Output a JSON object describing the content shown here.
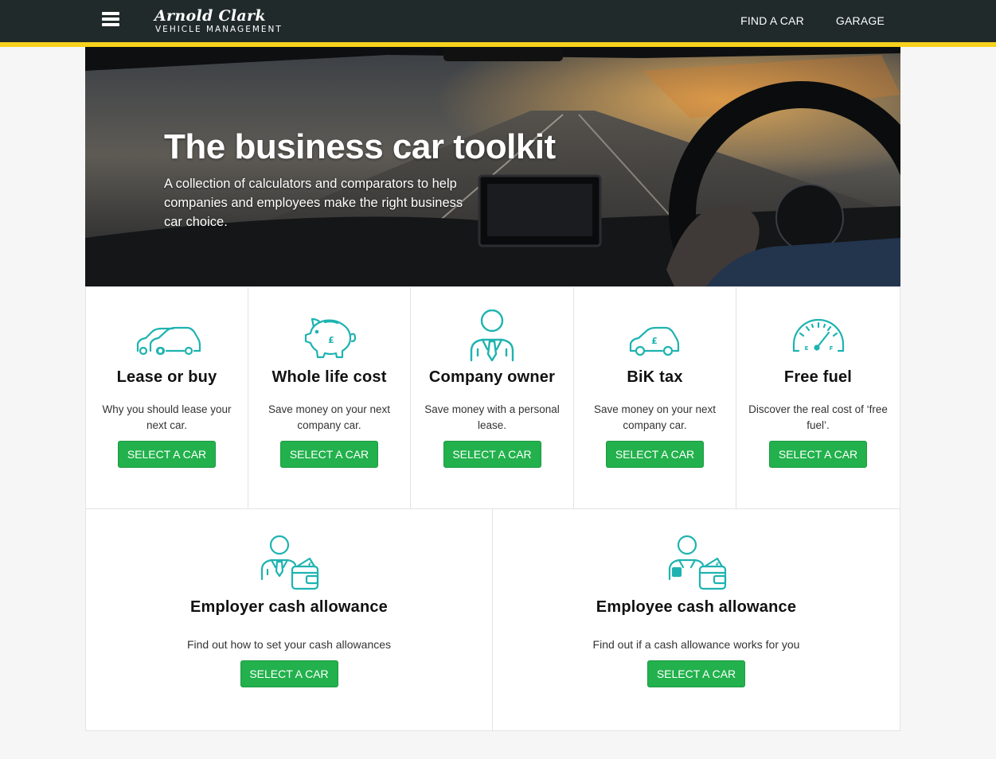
{
  "header": {
    "brand": "Arnold Clark",
    "brand_sub": "VEHICLE MANAGEMENT",
    "nav": [
      {
        "label": "FIND A CAR"
      },
      {
        "label": "GARAGE"
      }
    ]
  },
  "hero": {
    "title": "The business car toolkit",
    "text": "A collection of calculators and comparators to help companies and employees make the right business car choice."
  },
  "cards": [
    {
      "title": "Lease or buy",
      "desc": "Why you should lease your next car.",
      "button": "SELECT A CAR",
      "icon": "cars-icon"
    },
    {
      "title": "Whole life cost",
      "desc": "Save money on your next company car.",
      "button": "SELECT A CAR",
      "icon": "piggy-bank-icon"
    },
    {
      "title": "Company owner",
      "desc": "Save money with a personal lease.",
      "button": "SELECT A CAR",
      "icon": "business-person-icon"
    },
    {
      "title": "BiK tax",
      "desc": "Save money on your next company car.",
      "button": "SELECT A CAR",
      "icon": "car-pound-icon"
    },
    {
      "title": "Free fuel",
      "desc": "Discover the real cost of ‘free fuel’.",
      "button": "SELECT A CAR",
      "icon": "fuel-gauge-icon"
    },
    {
      "title": "Employer cash allowance",
      "desc": "Find out how to set your cash allowances",
      "button": "SELECT A CAR",
      "icon": "employer-wallet-icon"
    },
    {
      "title": "Employee cash allowance",
      "desc": "Find out if a cash allowance works for you",
      "button": "SELECT A CAR",
      "icon": "employee-wallet-icon"
    }
  ],
  "colors": {
    "header_bg": "#212a2a",
    "accent_yellow": "#f6d21c",
    "button_green": "#22b14c",
    "icon_teal": "#1eb3b1"
  }
}
